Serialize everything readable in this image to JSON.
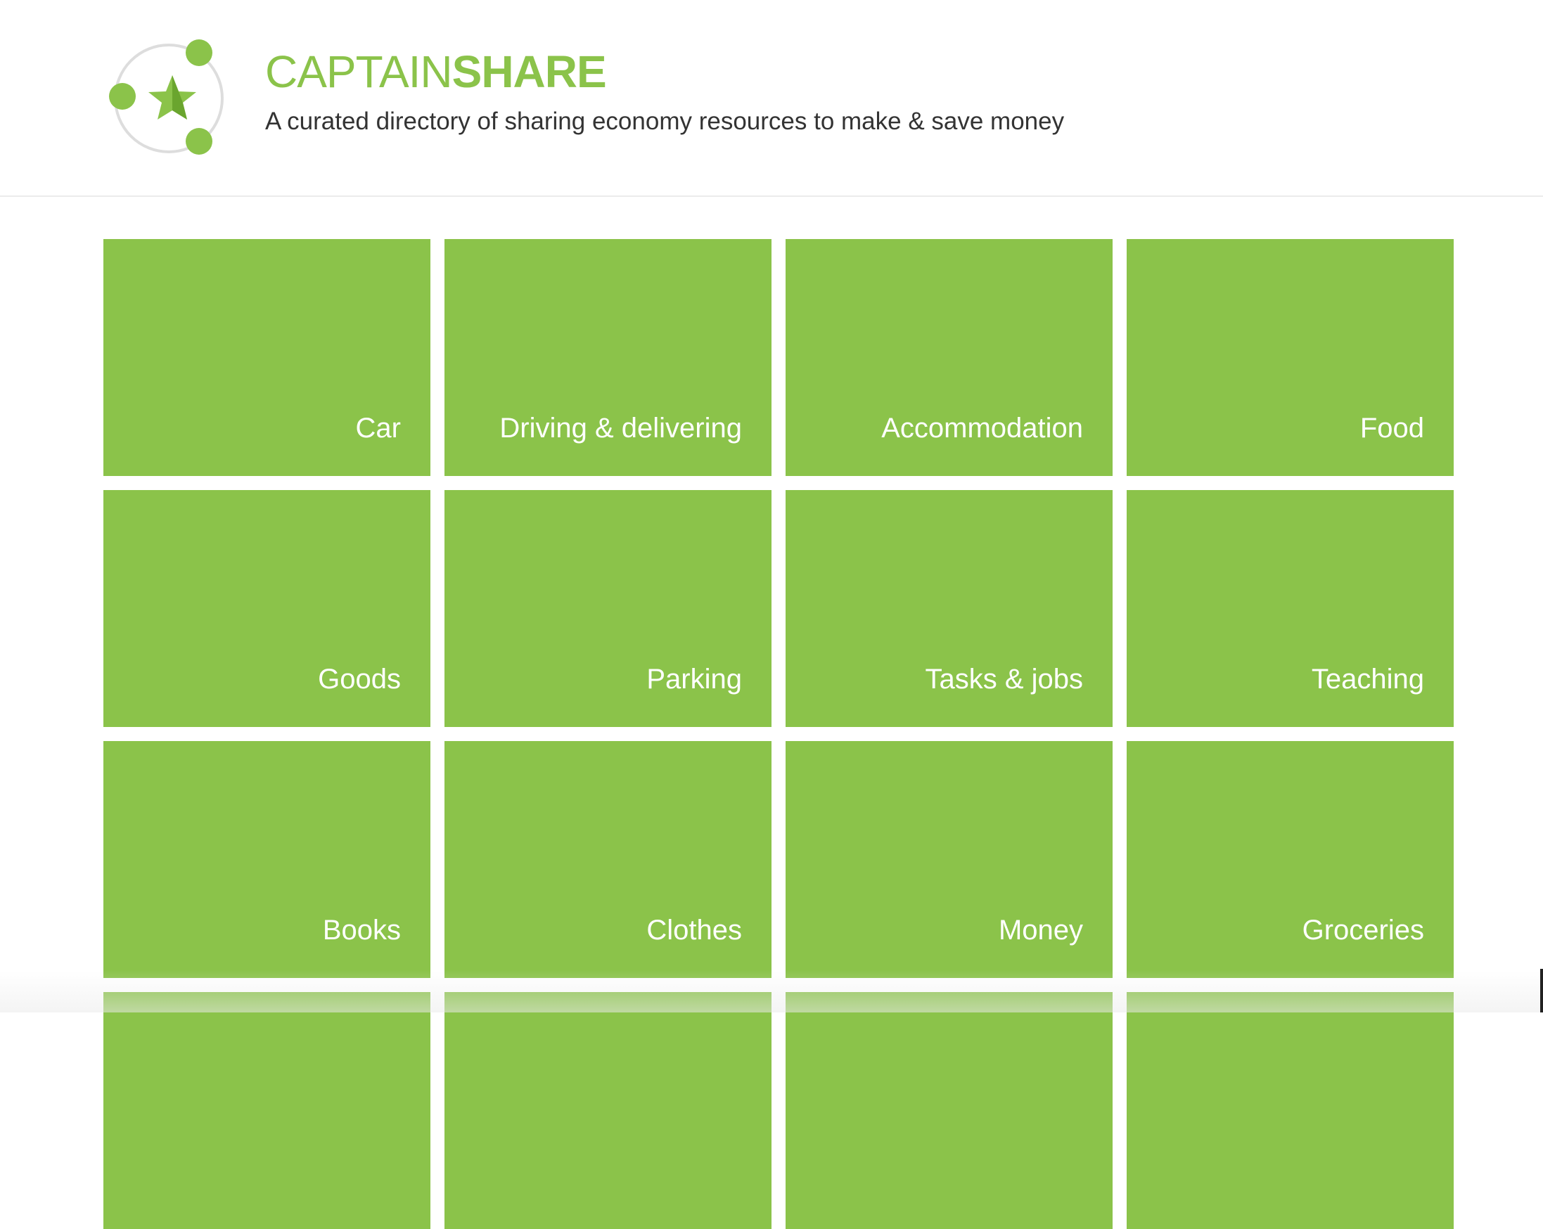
{
  "header": {
    "brand_light": "CAPTAIN",
    "brand_bold": "SHARE",
    "tagline": "A curated directory of sharing economy resources to make & save money",
    "logo_icon": "star-network-logo"
  },
  "colors": {
    "accent": "#8bc34a",
    "accent_dark": "#6aa52e",
    "ring": "#dddddd",
    "text": "#333333"
  },
  "categories": [
    {
      "label": "Car"
    },
    {
      "label": "Driving & delivering"
    },
    {
      "label": "Accommodation"
    },
    {
      "label": "Food"
    },
    {
      "label": "Goods"
    },
    {
      "label": "Parking"
    },
    {
      "label": "Tasks & jobs"
    },
    {
      "label": "Teaching"
    },
    {
      "label": "Books"
    },
    {
      "label": "Clothes"
    },
    {
      "label": "Money"
    },
    {
      "label": "Groceries"
    },
    {
      "label": ""
    },
    {
      "label": ""
    },
    {
      "label": ""
    },
    {
      "label": ""
    }
  ]
}
